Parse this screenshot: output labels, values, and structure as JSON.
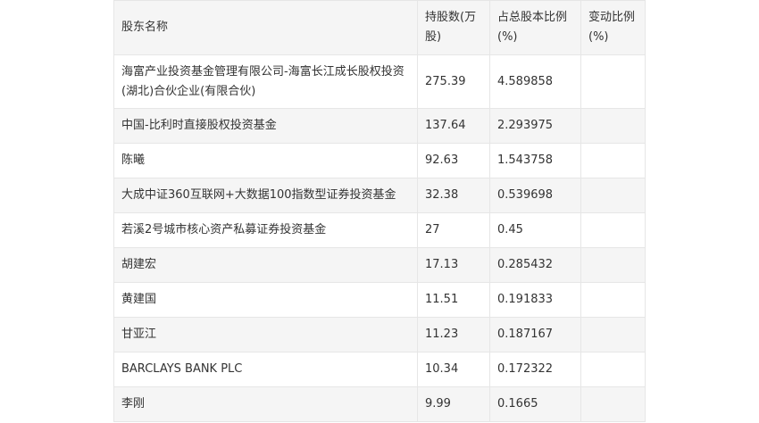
{
  "table": {
    "headers": [
      "股东名称",
      "持股数(万股)",
      "占总股本比例(%)",
      "变动比例(%)"
    ],
    "rows": [
      [
        "海富产业投资基金管理有限公司-海富长江成长股权投资(湖北)合伙企业(有限合伙)",
        "275.39",
        "4.589858",
        ""
      ],
      [
        "中国-比利时直接股权投资基金",
        "137.64",
        "2.293975",
        ""
      ],
      [
        "陈曦",
        "92.63",
        "1.543758",
        ""
      ],
      [
        "大成中证360互联网+大数据100指数型证券投资基金",
        "32.38",
        "0.539698",
        ""
      ],
      [
        "若溪2号城市核心资产私募证券投资基金",
        "27",
        "0.45",
        ""
      ],
      [
        "胡建宏",
        "17.13",
        "0.285432",
        ""
      ],
      [
        "黄建国",
        "11.51",
        "0.191833",
        ""
      ],
      [
        "甘亚江",
        "11.23",
        "0.187167",
        ""
      ],
      [
        "BARCLAYS BANK PLC",
        "10.34",
        "0.172322",
        ""
      ],
      [
        "李刚",
        "9.99",
        "0.1665",
        ""
      ]
    ]
  }
}
